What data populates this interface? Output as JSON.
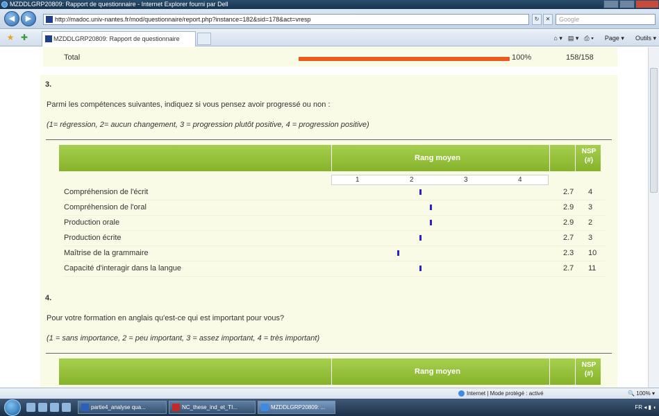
{
  "window": {
    "title": "MZDDLGRP20809: Rapport de questionnaire - Internet Explorer fourni par Dell"
  },
  "address_bar": {
    "url": "http://madoc.univ-nantes.fr/mod/questionnaire/report.php?instance=182&sid=178&act=vresp",
    "search_placeholder": "Google"
  },
  "tab": {
    "label": "MZDDLGRP20809: Rapport de questionnaire"
  },
  "command_bar": {
    "page": "Page",
    "tools": "Outils"
  },
  "total_row": {
    "label": "Total",
    "percent": "100%",
    "count": "158/158",
    "fill": 1.0
  },
  "question3": {
    "number": "3.",
    "text": "Parmi les compétences suivantes, indiquez si vous pensez avoir progressé ou non :",
    "legend": "(1= régression, 2= aucun changement, 3 = progression plutôt positive, 4 = progression positive)",
    "header_rank": "Rang moyen",
    "header_nsp": "NSP\n(#)",
    "scale": [
      "1",
      "2",
      "3",
      "4"
    ],
    "rows": [
      {
        "label": "Compréhension de l'écrit",
        "mean": "2.7",
        "value": 2.7,
        "nsp": "4"
      },
      {
        "label": "Compréhension de l'oral",
        "mean": "2.9",
        "value": 2.9,
        "nsp": "3"
      },
      {
        "label": "Production orale",
        "mean": "2.9",
        "value": 2.9,
        "nsp": "2"
      },
      {
        "label": "Production écrite",
        "mean": "2.7",
        "value": 2.7,
        "nsp": "3"
      },
      {
        "label": "Maîtrise de la grammaire",
        "mean": "2.3",
        "value": 2.3,
        "nsp": "10"
      },
      {
        "label": "Capacité d'interagir dans la langue",
        "mean": "2.7",
        "value": 2.7,
        "nsp": "11"
      }
    ]
  },
  "question4": {
    "number": "4.",
    "text": "Pour votre formation en anglais qu'est-ce qui est important pour vous?",
    "legend": "(1 = sans importance, 2 = peu important, 3 = assez important, 4 = très important)",
    "header_rank": "Rang moyen",
    "header_nsp": "NSP\n(#)"
  },
  "status_bar": {
    "zone": "Internet | Mode protégé : activé",
    "zoom": "100%"
  },
  "taskbar": {
    "items": [
      {
        "label": "partie4_analyse qua...",
        "color": "#2b5fb8"
      },
      {
        "label": "NC_these_ind_et_TI...",
        "color": "#c22a2a"
      },
      {
        "label": "MZDDLGRP20809: ...",
        "color": "#3c8be0"
      }
    ],
    "lang": "FR"
  },
  "colors": {
    "accent_green": "#94c03a",
    "bar_orange": "#e85b1d",
    "marker_blue": "#2e1dd6",
    "cream_bg": "#fafbe6"
  }
}
